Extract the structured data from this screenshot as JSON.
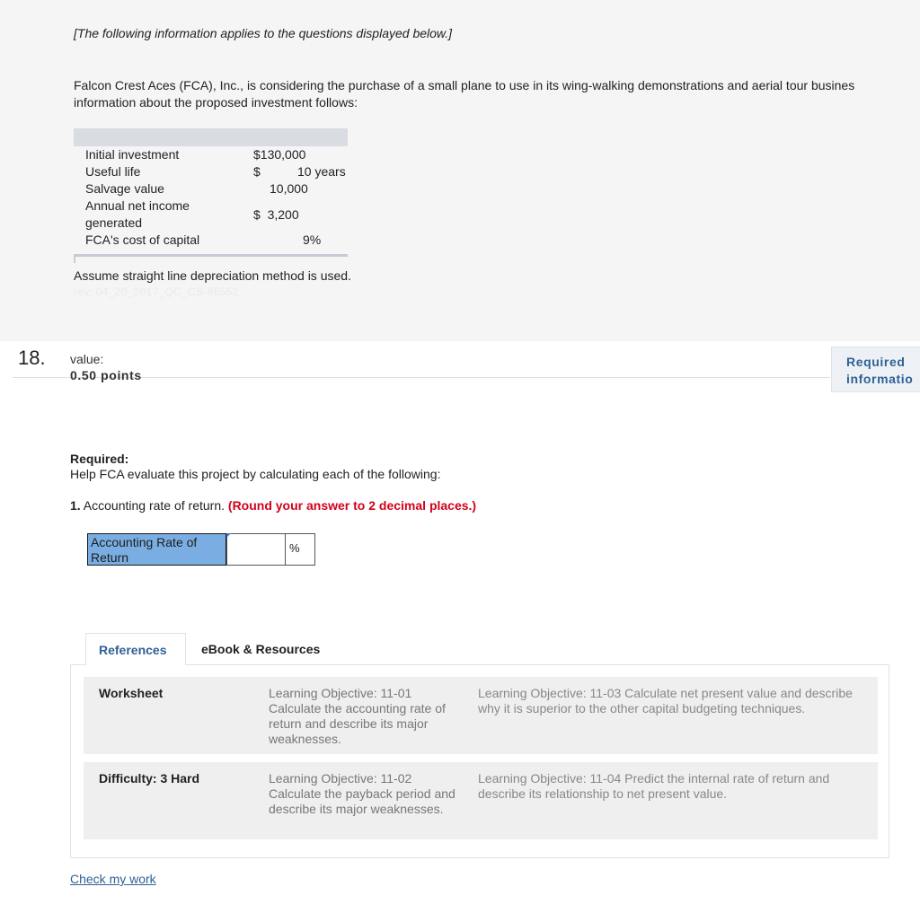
{
  "intro": "[The following information applies to the questions displayed below.]",
  "description": {
    "line1": "Falcon Crest Aces (FCA), Inc., is considering the purchase of a small plane to use in its wing-walking demonstrations and aerial tour busines",
    "line2": "information about the proposed investment follows:"
  },
  "info_table": {
    "rows": [
      {
        "label": "Initial investment",
        "value": "$130,000"
      },
      {
        "label": "Useful life",
        "prefix": "$",
        "value": "10 years"
      },
      {
        "label": "Salvage value",
        "value": "10,000"
      },
      {
        "label": "Annual net income",
        "label2": "generated",
        "value": "$  3,200"
      },
      {
        "label": "FCA's cost of capital",
        "value": "9%"
      }
    ]
  },
  "assumption": "Assume straight line depreciation method is used.",
  "ghost_text": "rev: 04_20_2017_QC_CS-86552",
  "question": {
    "number": "18.",
    "value_label": "value:",
    "points": "0.50 points",
    "required_button": {
      "line1": "Required",
      "line2": "informatio"
    }
  },
  "required": {
    "heading": "Required:",
    "help": "Help FCA evaluate this project by calculating each of the following:",
    "q1_number": "1.",
    "q1_text": " Accounting rate of return. ",
    "q1_hint": "(Round your answer to 2 decimal places.)"
  },
  "answer": {
    "label": "Accounting Rate of Return",
    "value": "",
    "unit": "%"
  },
  "tabs": {
    "references": "References",
    "ebook": "eBook & Resources"
  },
  "references": [
    {
      "col1": "Worksheet",
      "col2": "Learning Objective: 11-01 Calculate the accounting rate of return and describe its major weaknesses.",
      "col3": "Learning Objective: 11-03 Calculate net present value and describe why it is superior to the other capital budgeting techniques."
    },
    {
      "col1": "Difficulty: 3 Hard",
      "col2": "Learning Objective: 11-02 Calculate the payback period and describe its major weaknesses.",
      "col3": "Learning Objective: 11-04 Predict the internal rate of return and describe its relationship to net present value."
    }
  ],
  "check_my_work": "Check my work",
  "colors": {
    "accent_blue": "#2f6196",
    "answer_label_bg": "#7aaee2",
    "hint_red": "#d0021b"
  }
}
